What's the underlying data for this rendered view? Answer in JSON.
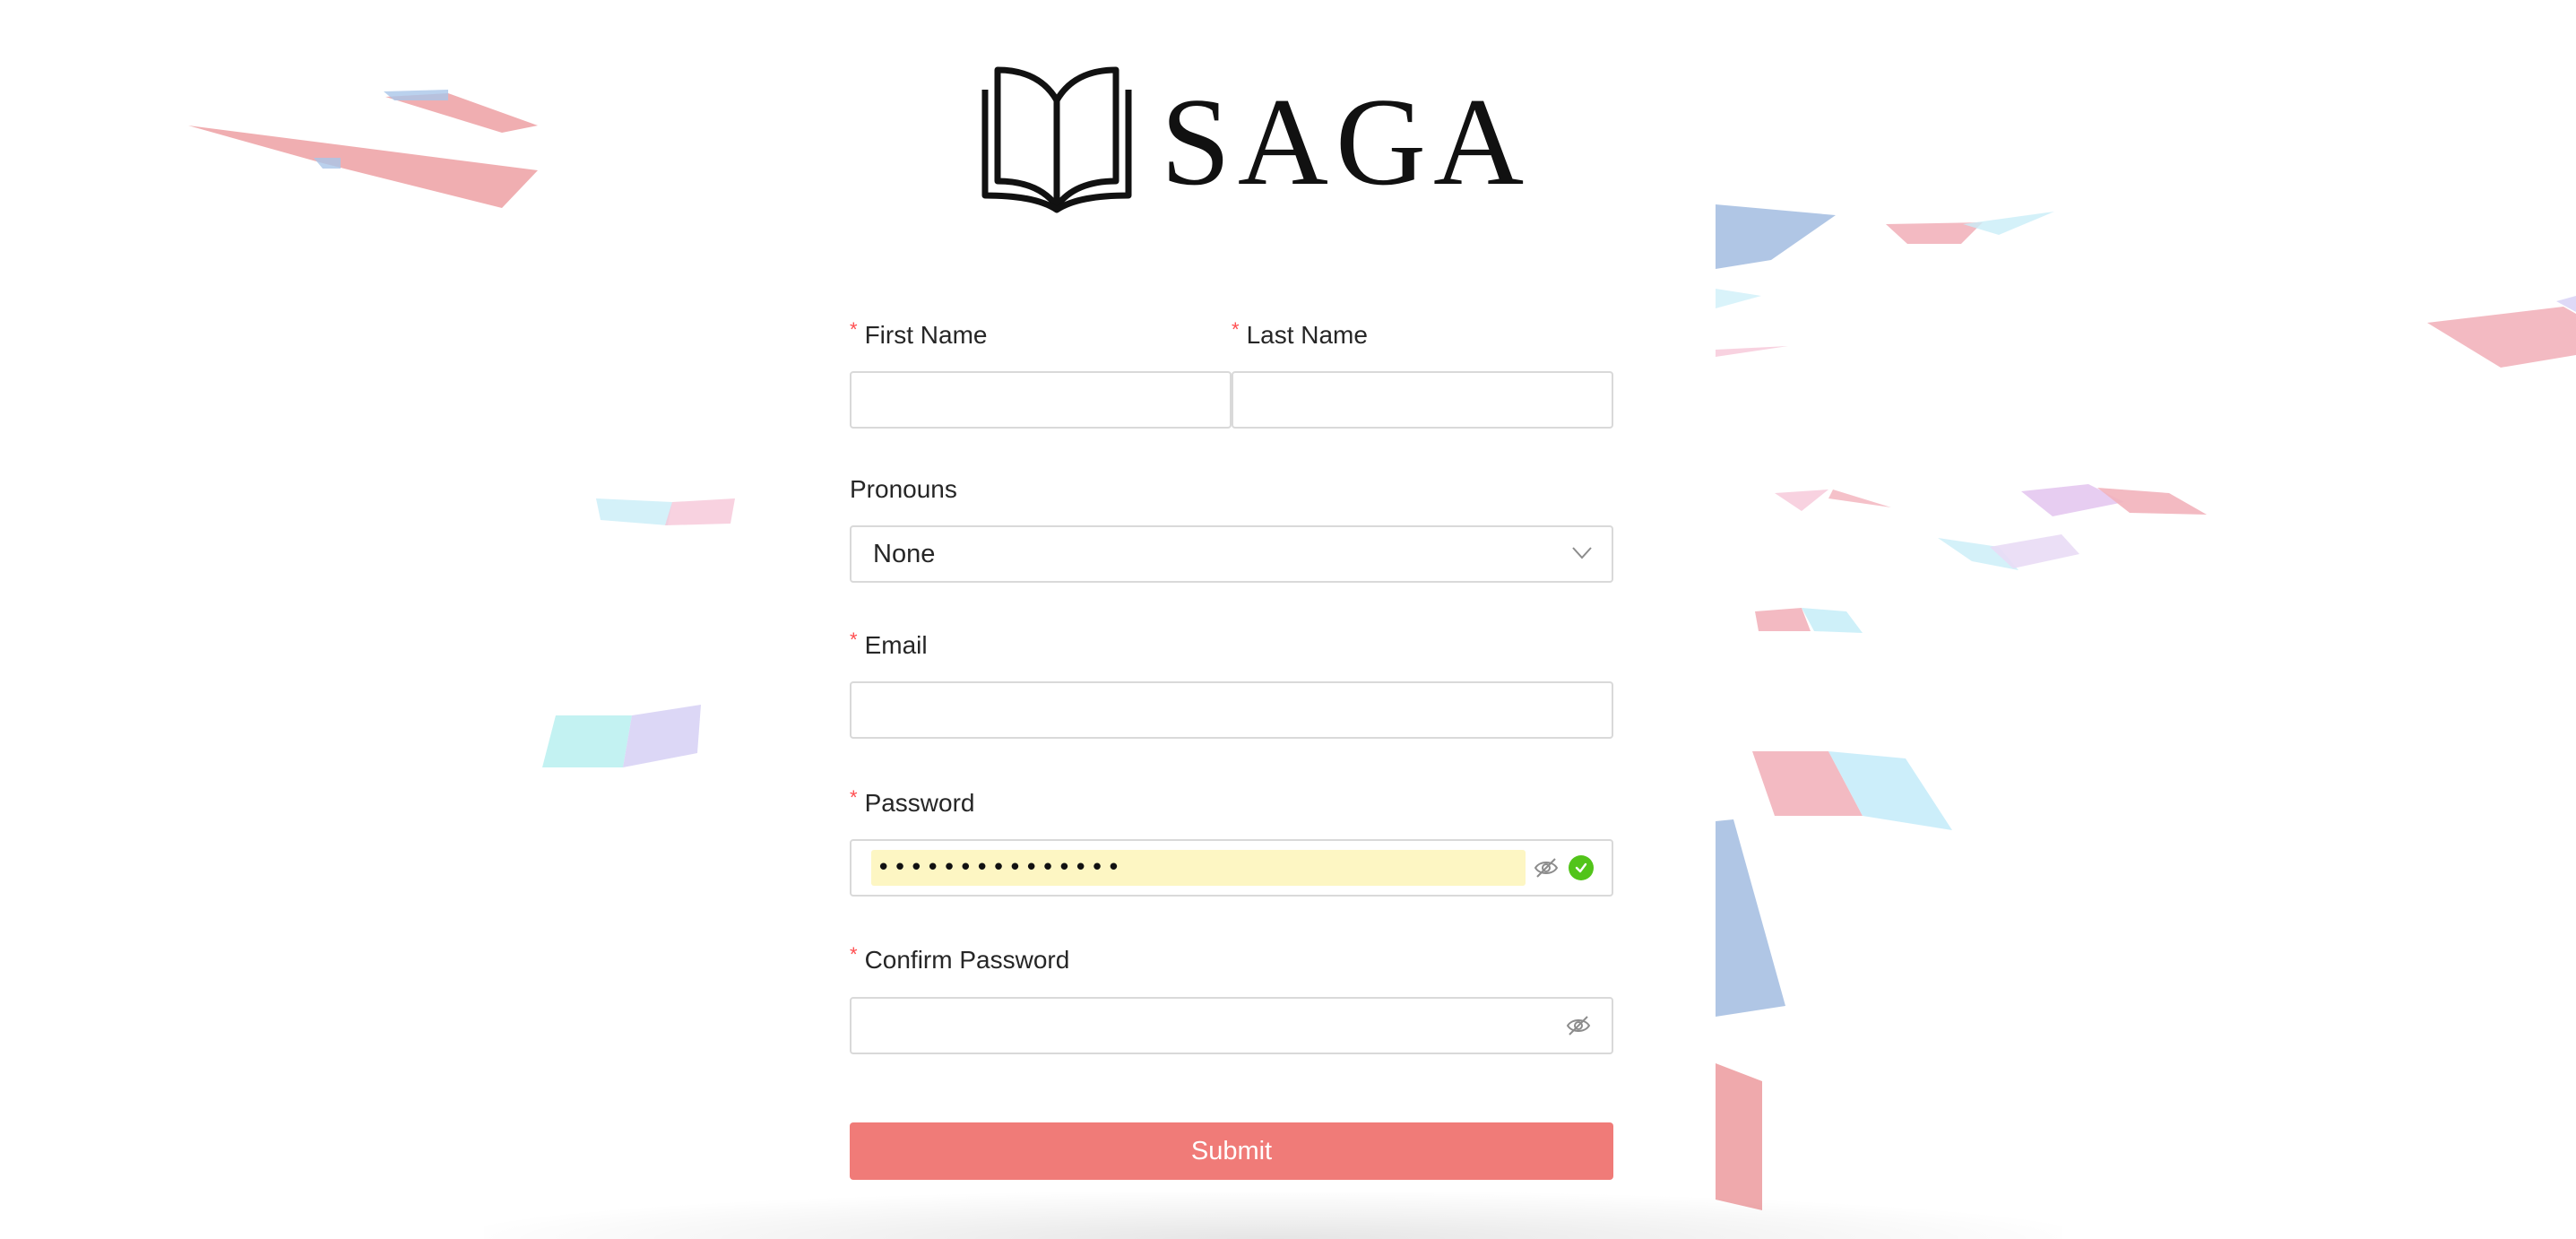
{
  "brand": {
    "name": "SAGA",
    "logo_icon": "open-book-icon"
  },
  "form": {
    "first_name": {
      "label": "First Name",
      "required_mark": "*",
      "value": ""
    },
    "last_name": {
      "label": "Last Name",
      "required_mark": "*",
      "value": ""
    },
    "pronouns": {
      "label": "Pronouns",
      "selected": "None",
      "icon": "chevron-down-icon"
    },
    "email": {
      "label": "Email",
      "required_mark": "*",
      "value": ""
    },
    "password": {
      "label": "Password",
      "required_mark": "*",
      "masked_value": "•••••••••••••••",
      "toggle_icon": "eye-hidden-icon",
      "status_icon": "check-circle-icon"
    },
    "confirm_password": {
      "label": "Confirm Password",
      "required_mark": "*",
      "value": "",
      "toggle_icon": "eye-hidden-icon"
    },
    "submit_label": "Submit"
  },
  "colors": {
    "accent": "#f07b78",
    "required": "#ff4d4f",
    "success": "#52c41a",
    "autofill": "#fdf6c3",
    "border": "#d9d9d9"
  }
}
